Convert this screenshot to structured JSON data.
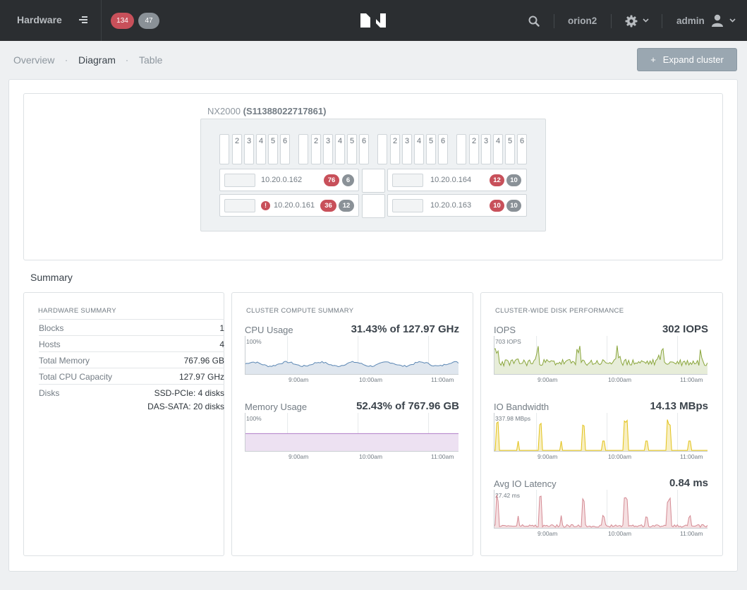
{
  "topbar": {
    "section": "Hardware",
    "alerts_count": "134",
    "events_count": "47",
    "cluster_name": "orion2",
    "user": "admin"
  },
  "subnav": {
    "tabs": [
      {
        "label": "Overview",
        "active": false
      },
      {
        "label": "Diagram",
        "active": true
      },
      {
        "label": "Table",
        "active": false
      }
    ],
    "separator": "·",
    "expand_button": "Expand cluster",
    "expand_icon": "+"
  },
  "diagram": {
    "model": "NX2000",
    "serial": "(S11388022717861)",
    "slot_groups": [
      [
        "",
        "2",
        "3",
        "4",
        "5",
        "6"
      ],
      [
        "",
        "2",
        "3",
        "4",
        "5",
        "6"
      ],
      [
        "",
        "2",
        "3",
        "4",
        "5",
        "6"
      ],
      [
        "",
        "2",
        "3",
        "4",
        "5",
        "6"
      ]
    ],
    "nodes": [
      {
        "ip": "10.20.0.162",
        "critical": "76",
        "warning": "6",
        "alert": false
      },
      {
        "ip": "10.20.0.164",
        "critical": "12",
        "warning": "10",
        "alert": false
      },
      {
        "ip": "10.20.0.161",
        "critical": "36",
        "warning": "12",
        "alert": true,
        "alert_glyph": "!"
      },
      {
        "ip": "10.20.0.163",
        "critical": "10",
        "warning": "10",
        "alert": false
      }
    ]
  },
  "summary": {
    "title": "Summary",
    "hardware": {
      "title": "HARDWARE SUMMARY",
      "rows": [
        {
          "label": "Blocks",
          "value": "1"
        },
        {
          "label": "Hosts",
          "value": "4"
        },
        {
          "label": "Total Memory",
          "value": "767.96 GB"
        },
        {
          "label": "Total CPU Capacity",
          "value": "127.97 GHz"
        }
      ],
      "disks_label": "Disks",
      "disks_values": [
        "SSD-PCIe: 4 disks",
        "DAS-SATA: 20 disks"
      ]
    },
    "compute": {
      "title": "CLUSTER COMPUTE SUMMARY",
      "metrics": [
        {
          "label": "CPU Usage",
          "value": "31.43% of 127.97 GHz",
          "max": "100%",
          "percent": 31.43,
          "color": "#5b87b4",
          "fill": "#dfe6ee"
        },
        {
          "label": "Memory Usage",
          "value": "52.43% of 767.96 GB",
          "max": "100%",
          "percent": 52.43,
          "color": "#b07cc6",
          "fill": "#ede1f2"
        }
      ]
    },
    "disk": {
      "title": "CLUSTER-WIDE DISK PERFORMANCE",
      "metrics": [
        {
          "label": "IOPS",
          "value": "302 IOPS",
          "max": "703 IOPS",
          "color": "#8aa63c",
          "fill": "#e7edd9"
        },
        {
          "label": "IO Bandwidth",
          "value": "14.13 MBps",
          "max": "337.98 MBps",
          "color": "#e2c21a",
          "fill": "#f8efc2"
        },
        {
          "label": "Avg IO Latency",
          "value": "0.84 ms",
          "max": "27.42 ms",
          "color": "#d48a93",
          "fill": "#f5dfe1"
        }
      ]
    },
    "time_ticks": [
      "9:00am",
      "10:00am",
      "11:00am"
    ]
  }
}
